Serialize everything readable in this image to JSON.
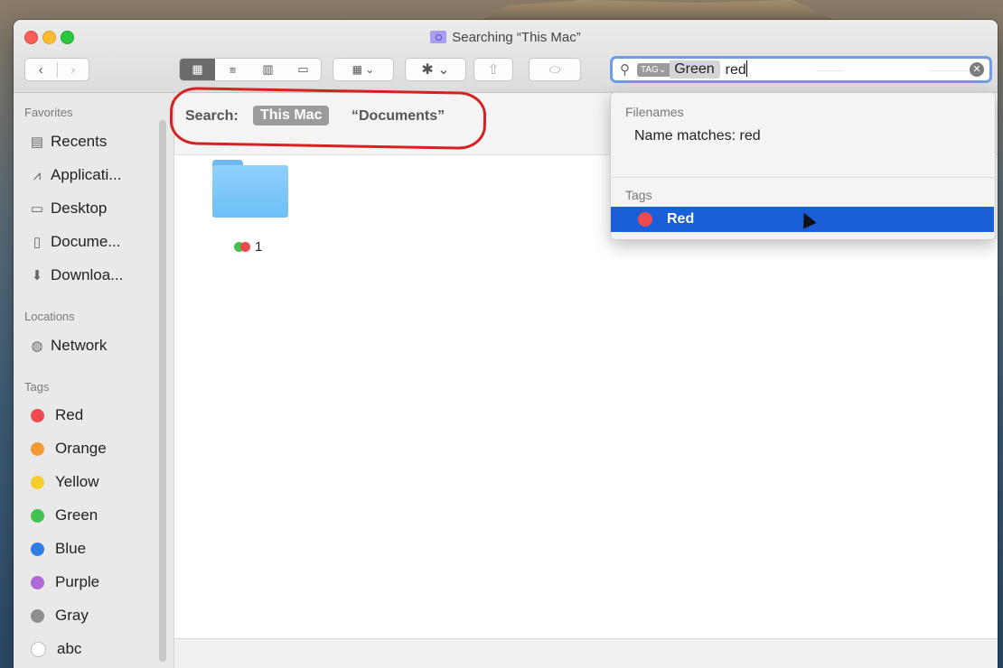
{
  "window": {
    "title": "Searching “This Mac”"
  },
  "toolbar": {
    "back": "‹",
    "forward": "›",
    "views": [
      "▦",
      "≡",
      "▥",
      "▭"
    ],
    "group": "▦ ⌄",
    "action": "✱ ⌄",
    "share": "⇧",
    "tag": "⬭"
  },
  "search": {
    "token_type": "TAG⌄",
    "token_value": "Green",
    "typed": "red"
  },
  "scope": {
    "label": "Search:",
    "this_mac": "This Mac",
    "documents": "“Documents”"
  },
  "sidebar": {
    "favorites_header": "Favorites",
    "favorites": [
      {
        "label": "Recents",
        "icon": "recents-icon"
      },
      {
        "label": "Applicati...",
        "icon": "applications-icon"
      },
      {
        "label": "Desktop",
        "icon": "desktop-icon"
      },
      {
        "label": "Docume...",
        "icon": "documents-icon"
      },
      {
        "label": "Downloa...",
        "icon": "downloads-icon"
      }
    ],
    "locations_header": "Locations",
    "locations": [
      {
        "label": "Network",
        "icon": "network-icon"
      }
    ],
    "tags_header": "Tags",
    "tags": [
      {
        "label": "Red",
        "color": "#ee4a4f"
      },
      {
        "label": "Orange",
        "color": "#f39a35"
      },
      {
        "label": "Yellow",
        "color": "#f5cd2c"
      },
      {
        "label": "Green",
        "color": "#43c24f"
      },
      {
        "label": "Blue",
        "color": "#2c7de6"
      },
      {
        "label": "Purple",
        "color": "#b069d6"
      },
      {
        "label": "Gray",
        "color": "#8e8e8e"
      },
      {
        "label": "abc",
        "color": "#ffffff"
      }
    ]
  },
  "results": [
    {
      "name": "1",
      "tags": [
        "#43c24f",
        "#ee4a4f"
      ]
    }
  ],
  "suggestions": {
    "filenames_header": "Filenames",
    "name_match": "Name matches: red",
    "tags_header": "Tags",
    "tag_match": "Red",
    "tag_color": "#ee4a4f"
  }
}
